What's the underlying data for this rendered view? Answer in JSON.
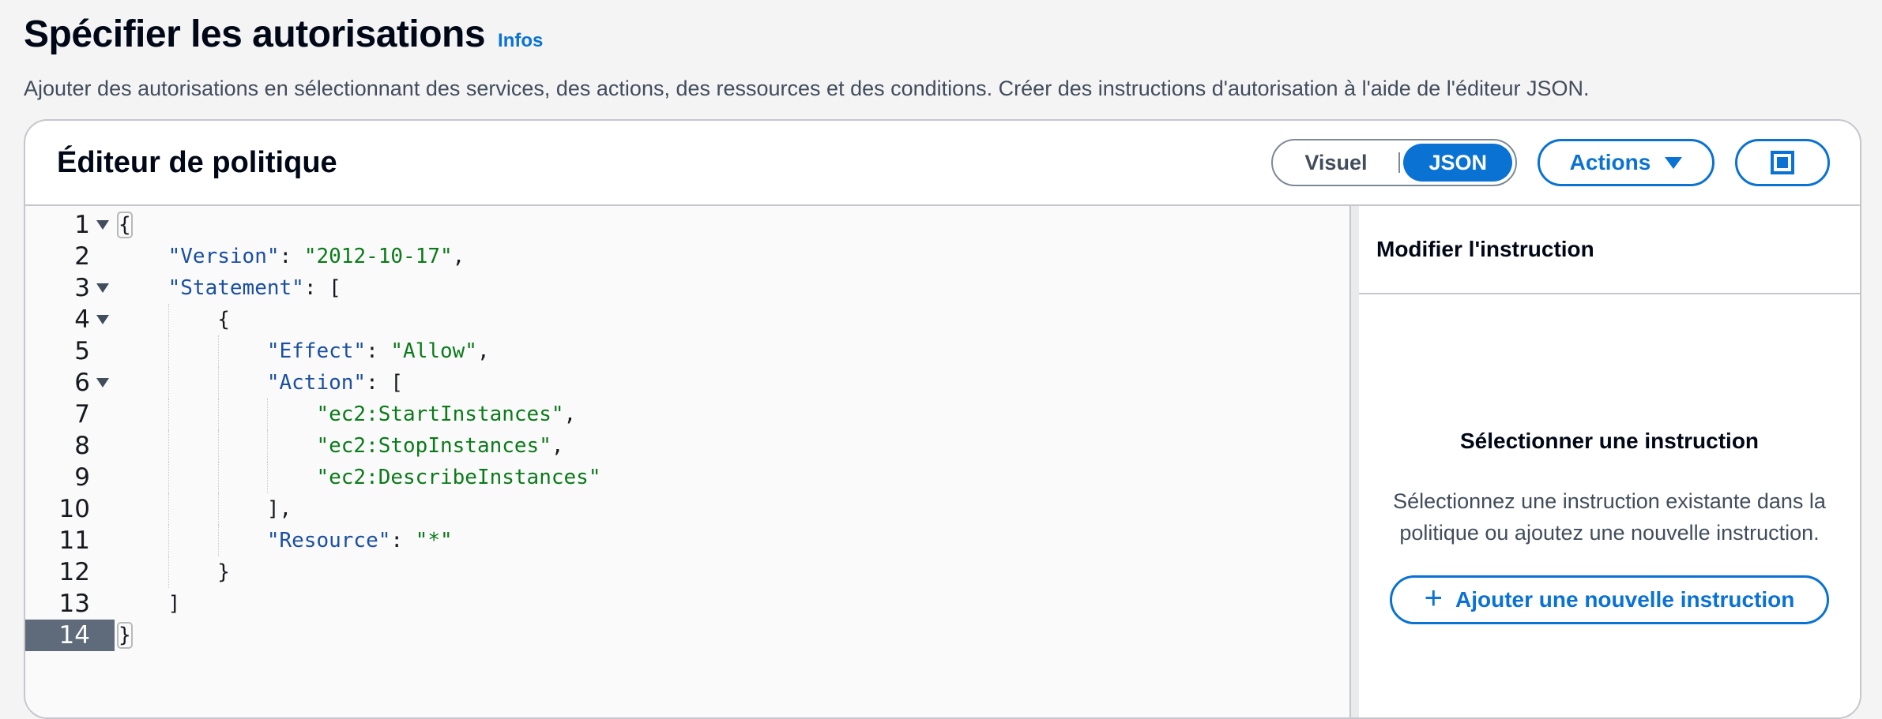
{
  "page": {
    "title": "Spécifier les autorisations",
    "info_link": "Infos",
    "description": "Ajouter des autorisations en sélectionnant des services, des actions, des ressources et des conditions. Créer des instructions d'autorisation à l'aide de l'éditeur JSON."
  },
  "panel": {
    "title": "Éditeur de politique",
    "toggle": {
      "visual_label": "Visuel",
      "json_label": "JSON",
      "selected": "JSON"
    },
    "actions_label": "Actions",
    "split_icon": "split-panel-icon"
  },
  "editor": {
    "lines": [
      {
        "number": "1",
        "foldable": true,
        "text": "{"
      },
      {
        "number": "2",
        "foldable": false,
        "key": "\"Version\"",
        "sep": ": ",
        "value": "\"2012-10-17\"",
        "tail": ",",
        "indent": "    "
      },
      {
        "number": "3",
        "foldable": true,
        "key": "\"Statement\"",
        "sep": ": ",
        "tail": "[",
        "indent": "    "
      },
      {
        "number": "4",
        "foldable": true,
        "text": "{",
        "indent": "        "
      },
      {
        "number": "5",
        "foldable": false,
        "key": "\"Effect\"",
        "sep": ": ",
        "value": "\"Allow\"",
        "tail": ",",
        "indent": "            "
      },
      {
        "number": "6",
        "foldable": true,
        "key": "\"Action\"",
        "sep": ": ",
        "tail": "[",
        "indent": "            "
      },
      {
        "number": "7",
        "foldable": false,
        "value": "\"ec2:StartInstances\"",
        "tail": ",",
        "indent": "                "
      },
      {
        "number": "8",
        "foldable": false,
        "value": "\"ec2:StopInstances\"",
        "tail": ",",
        "indent": "                "
      },
      {
        "number": "9",
        "foldable": false,
        "value": "\"ec2:DescribeInstances\"",
        "tail": "",
        "indent": "                "
      },
      {
        "number": "10",
        "foldable": false,
        "text": "],",
        "indent": "            "
      },
      {
        "number": "11",
        "foldable": false,
        "key": "\"Resource\"",
        "sep": ": ",
        "value": "\"*\"",
        "tail": "",
        "indent": "            "
      },
      {
        "number": "12",
        "foldable": false,
        "text": "}",
        "indent": "        "
      },
      {
        "number": "13",
        "foldable": false,
        "text": "]",
        "indent": "    "
      },
      {
        "number": "14",
        "foldable": false,
        "text": "}",
        "active": true
      }
    ]
  },
  "side_panel": {
    "header": "Modifier l'instruction",
    "empty_title": "Sélectionner une instruction",
    "empty_text": "Sélectionnez une instruction existante dans la politique ou ajoutez une nouvelle instruction.",
    "add_button_label": "Ajouter une nouvelle instruction",
    "add_icon": "+"
  },
  "colors": {
    "accent": "#0972d3",
    "json_key": "#1a4fa3",
    "json_string": "#0b7a1a",
    "active_line": "#5f6b7a"
  }
}
